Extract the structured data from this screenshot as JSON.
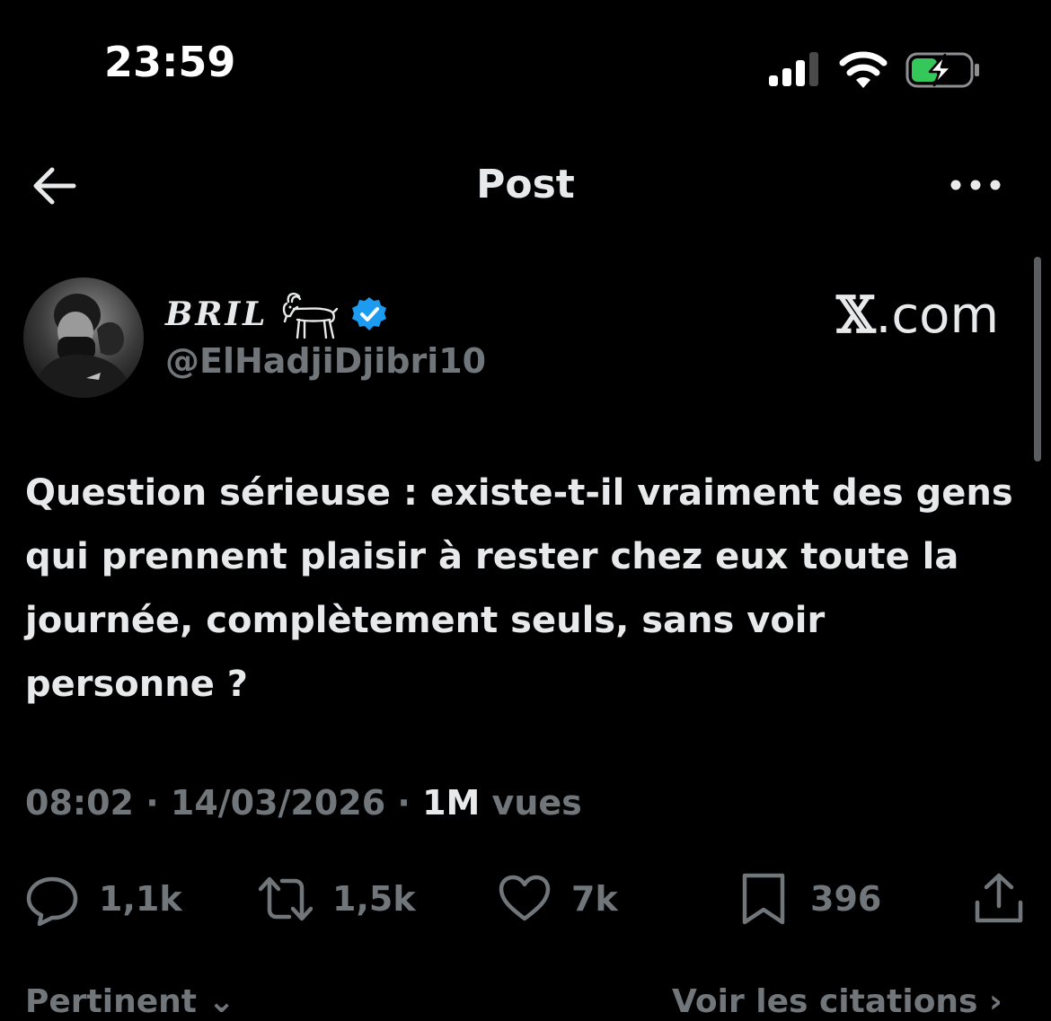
{
  "status_bar": {
    "time": "23:59"
  },
  "header": {
    "title": "Post"
  },
  "author": {
    "display_name": "BRIL",
    "handle": "@ElHadjiDjibri10"
  },
  "watermark": {
    "x_mark": "𝕏",
    "domain": ".com"
  },
  "tweet": {
    "text": "Question sérieuse : existe-t-il vraiment des gens qui prennent plaisir à rester chez eux toute la journée, complètement seuls, sans voir personne ?",
    "time": "08:02",
    "separator": " · ",
    "date": "14/03/2026",
    "views_count": "1M",
    "views_label": " vues"
  },
  "actions": {
    "replies": "1,1k",
    "reposts": "1,5k",
    "likes": "7k",
    "bookmarks": "396"
  },
  "bottom": {
    "sort_label": "Pertinent",
    "quotes_label": "Voir les citations"
  },
  "colors": {
    "background": "#000000",
    "text": "#e7e9ea",
    "muted": "#71767b",
    "verified": "#1d9bf0",
    "battery": "#34c759"
  }
}
